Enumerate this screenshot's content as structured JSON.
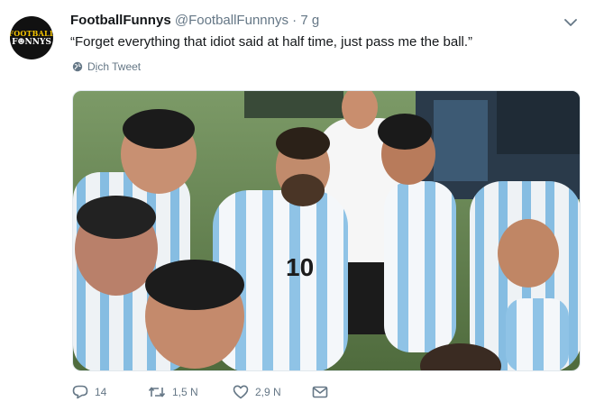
{
  "tweet": {
    "avatar": {
      "line1": "FOOTBALL",
      "line2": "F☻NNYS"
    },
    "display_name": "FootballFunnys",
    "handle": "@FootballFunnnys",
    "separator": "·",
    "time": "7 g",
    "text": "“Forget everything that idiot said at half time, just pass me the ball.”",
    "translate_label": "Dịch Tweet",
    "actions": {
      "reply_count": "14",
      "retweet_count": "1,5 N",
      "like_count": "2,9 N"
    }
  },
  "icons": {
    "caret": "chevron-down-icon",
    "translate": "globe-icon",
    "reply": "reply-icon",
    "retweet": "retweet-icon",
    "like": "heart-icon",
    "message": "envelope-icon"
  },
  "colors": {
    "text": "#14171a",
    "secondary": "#657786",
    "media_grass": "#5f7f4c",
    "jersey_blue": "#8fc3e6"
  }
}
